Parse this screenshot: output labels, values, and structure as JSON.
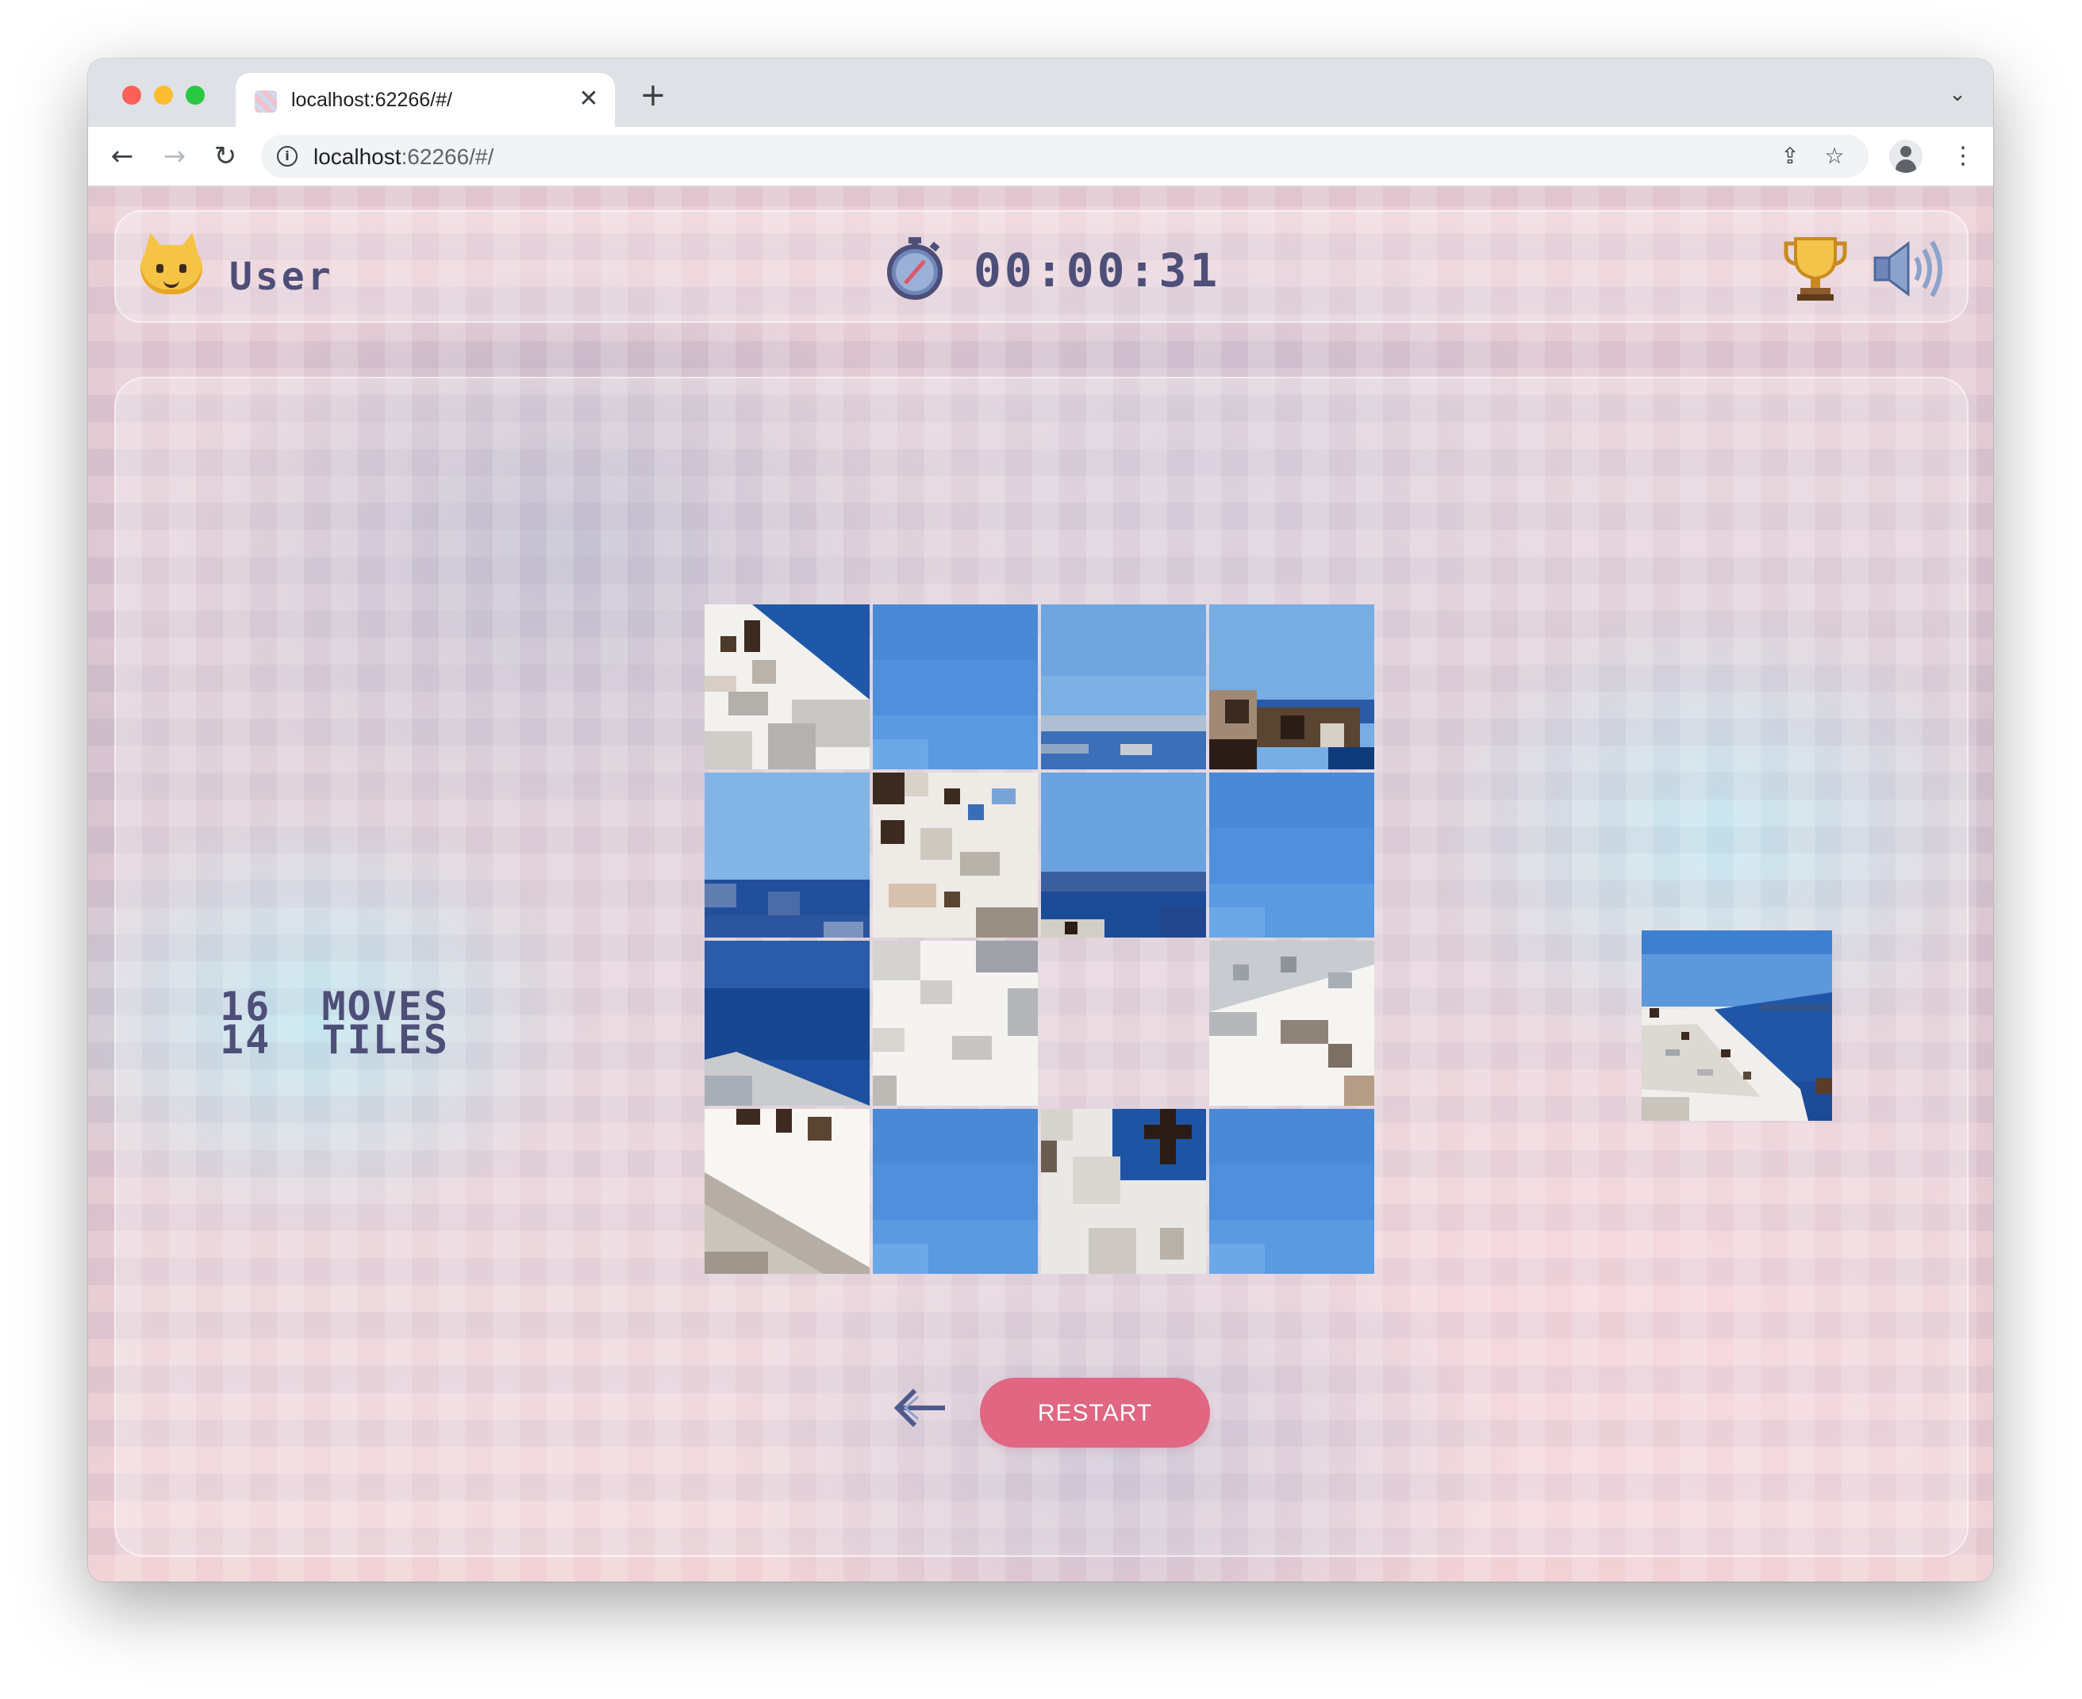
{
  "browser": {
    "tab_title": "localhost:62266/#/",
    "url_host": "localhost",
    "url_rest": ":62266/#/",
    "icons": [
      "info-icon",
      "share-icon",
      "star-icon",
      "profile-icon",
      "menu-icon",
      "back-icon",
      "forward-icon",
      "reload-icon",
      "close-icon",
      "plus-icon",
      "chevron-down-icon"
    ]
  },
  "header": {
    "username": "User",
    "timer": "00:00:31",
    "icons": {
      "avatar": "cat-avatar-icon",
      "timer": "stopwatch-icon",
      "leaderboard": "trophy-icon",
      "sound": "speaker-icon"
    }
  },
  "stats": {
    "moves_count": "16",
    "moves_label": "MOVES",
    "tiles_count": "14",
    "tiles_label": "TILES"
  },
  "puzzle": {
    "grid_size": 4,
    "tiles": [
      {
        "kind": "roof-cross"
      },
      {
        "kind": "sky"
      },
      {
        "kind": "sky-horizon"
      },
      {
        "kind": "sky-rocks"
      },
      {
        "kind": "sky-sea"
      },
      {
        "kind": "white-houses"
      },
      {
        "kind": "sky-sea-dark"
      },
      {
        "kind": "sky"
      },
      {
        "kind": "deep-sea"
      },
      {
        "kind": "white-houses-2"
      },
      {
        "kind": "empty"
      },
      {
        "kind": "white-steps"
      },
      {
        "kind": "white-slope"
      },
      {
        "kind": "sky"
      },
      {
        "kind": "white-cross"
      },
      {
        "kind": "sky"
      }
    ]
  },
  "preview_image": "reference-photo-thumbnail",
  "controls": {
    "back_icon": "arrow-left-icon",
    "restart_label": "RESTART"
  },
  "colors": {
    "text": "#4e4f79",
    "accent": "#e06682"
  }
}
